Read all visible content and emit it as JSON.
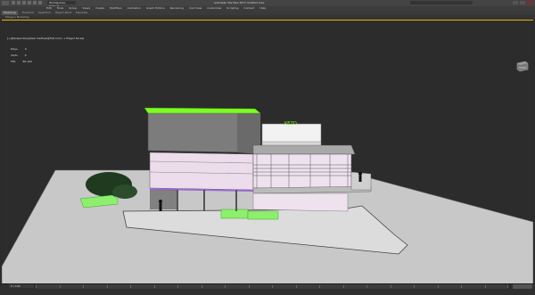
{
  "title_bar": {
    "workspace": "Workspaces: Default",
    "title": "Autodesk 3ds Max 2017   Untitled.max"
  },
  "menu": {
    "items": [
      "Edit",
      "Tools",
      "Group",
      "Views",
      "Create",
      "Modifiers",
      "Animation",
      "Graph Editors",
      "Rendering",
      "Civil View",
      "Customize",
      "Scripting",
      "Content",
      "Help"
    ]
  },
  "ribbon": {
    "tabs": [
      "Modeling",
      "Freeform",
      "Selection",
      "Object Paint",
      "Populate"
    ],
    "active_tab": "Modeling",
    "panel_label": "Polygon Modeling"
  },
  "viewport": {
    "label": "[+][Perspective][User Defined][Flat Color + Edged Faces]",
    "stats": [
      {
        "label": "Polys",
        "value": "0"
      },
      {
        "label": "Verts",
        "value": "0"
      },
      {
        "label": "FPS",
        "value": "85.194"
      }
    ],
    "sign_text": "KEZO",
    "viewcube_label": "FRONT"
  },
  "timeline": {
    "frame": "0 / 100"
  },
  "colors": {
    "highlight_green": "#7cfc20",
    "wall_lavender": "#f0dff0",
    "roof_gray": "#7a7a7a",
    "ground": "#c8c8c8"
  }
}
